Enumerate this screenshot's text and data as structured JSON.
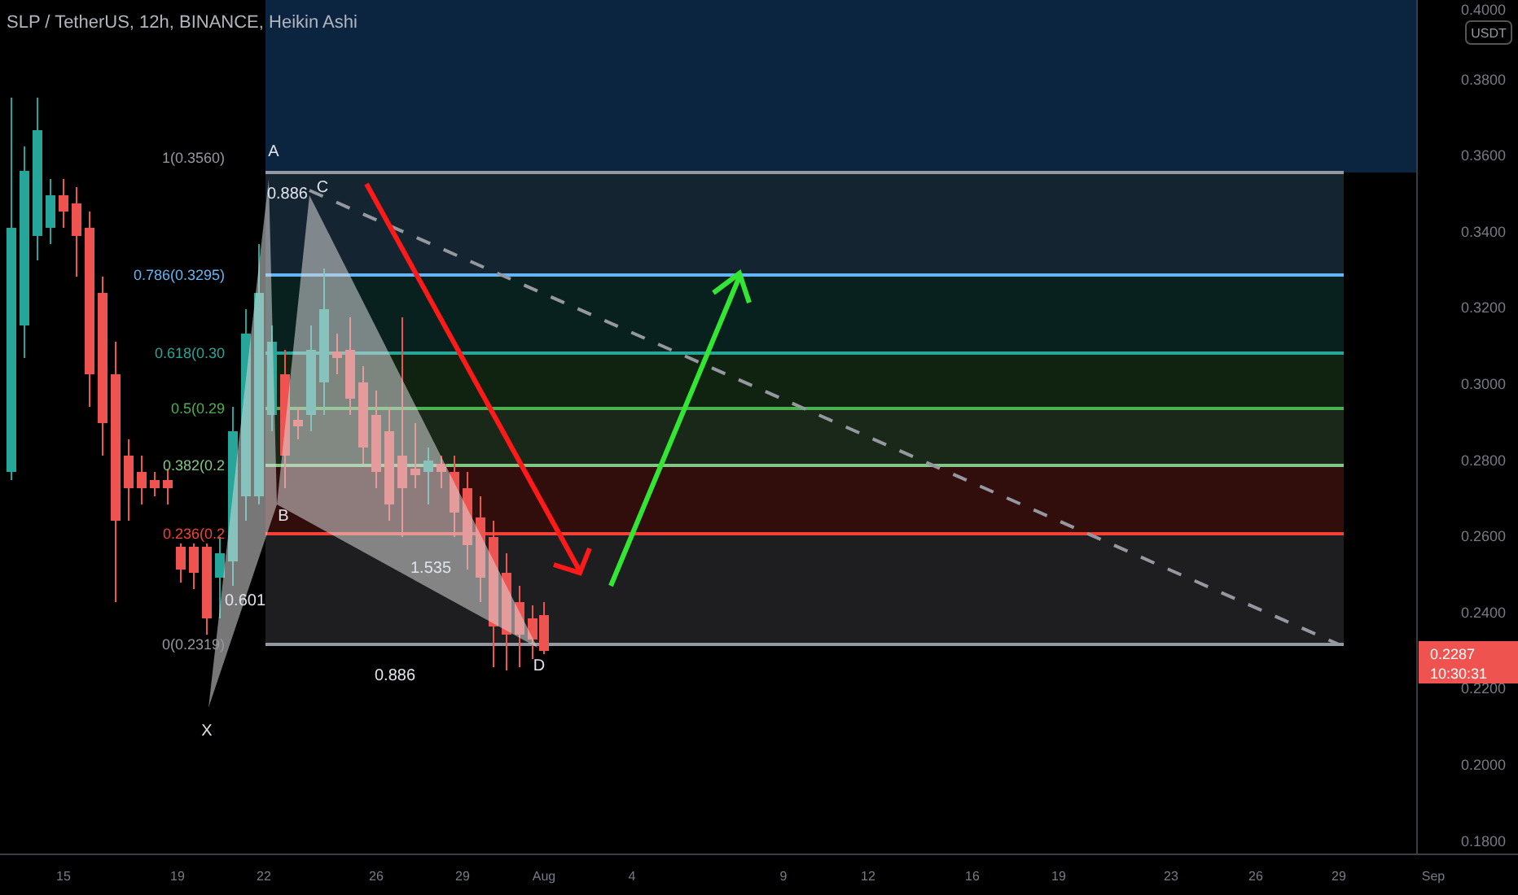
{
  "header": {
    "title": "SLP / TetherUS, 12h, BINANCE, Heikin Ashi"
  },
  "price_axis": {
    "currency": "USDT",
    "ticks": [
      "0.4000",
      "0.3800",
      "0.3600",
      "0.3400",
      "0.3200",
      "0.3000",
      "0.2800",
      "0.2600",
      "0.2400",
      "0.2200",
      "0.2000",
      "0.1800"
    ],
    "last_price": "0.2287",
    "countdown": "10:30:31"
  },
  "time_axis": {
    "ticks": [
      "15",
      "19",
      "22",
      "26",
      "29",
      "Aug",
      "4",
      "9",
      "12",
      "16",
      "19",
      "23",
      "26",
      "29",
      "Sep"
    ]
  },
  "fib_levels": [
    {
      "label": "1(0.3560)",
      "color": "#9598a1"
    },
    {
      "label": "0.786(0.3295)",
      "color": "#64b5f6"
    },
    {
      "label": "0.618(0.30",
      "color": "#26a69a"
    },
    {
      "label": "0.5(0.29",
      "color": "#4caf50"
    },
    {
      "label": "0.382(0.2",
      "color": "#81c784"
    },
    {
      "label": "0.236(0.2",
      "color": "#f44336"
    },
    {
      "label": "0(0.2319)",
      "color": "#9598a1"
    }
  ],
  "pattern": {
    "points": [
      "X",
      "A",
      "B",
      "C",
      "D"
    ],
    "ratios": [
      "0.886",
      "0.601",
      "1.535",
      "0.886"
    ]
  }
}
